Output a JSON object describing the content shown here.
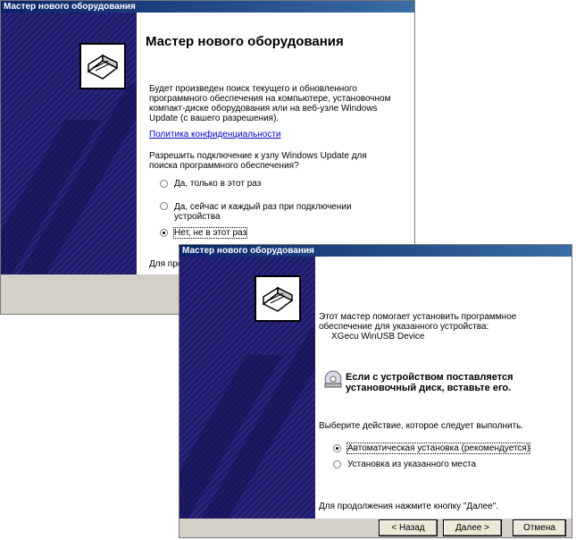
{
  "window1": {
    "title": "Мастер нового оборудования",
    "heading": "Мастер нового оборудования",
    "intro": "Будет произведен поиск текущего и обновленного программного обеспечения на компьютере, установочном компакт-диске оборудования или на веб-узле Windows Update (с вашего разрешения).",
    "privacy_link": "Политика конфиденциальности",
    "question": "Разрешить подключение к узлу Windows Update для поиска программного обеспечения?",
    "options": [
      {
        "label": "Да, только в этот раз",
        "checked": false
      },
      {
        "label": "Да, сейчас и каждый раз при подключении устройства",
        "checked": false
      },
      {
        "label": "Нет, не в этот раз",
        "checked": true
      }
    ],
    "footer_partial": "Для про"
  },
  "window2": {
    "title": "Мастер нового оборудования",
    "intro": "Этот мастер помогает установить программное обеспечение для указанного устройства:",
    "device": "XGecu WinUSB Device",
    "cd_notice": "Если с устройством поставляется установочный диск, вставьте его.",
    "choose": "Выберите действие, которое следует выполнить.",
    "options": [
      {
        "label": "Автоматическая установка (рекомендуется)",
        "checked": true
      },
      {
        "label": "Установка из указанного места",
        "checked": false
      }
    ],
    "continue_hint": "Для продолжения нажмите кнопку \"Далее\".",
    "buttons": {
      "back": "< Назад",
      "next": "Далее >",
      "cancel": "Отмена"
    }
  },
  "colors": {
    "titlebar": "#0a246a",
    "side_panel": "#1f1c6b",
    "dialog": "#ece9d8",
    "link": "#0000cc"
  }
}
